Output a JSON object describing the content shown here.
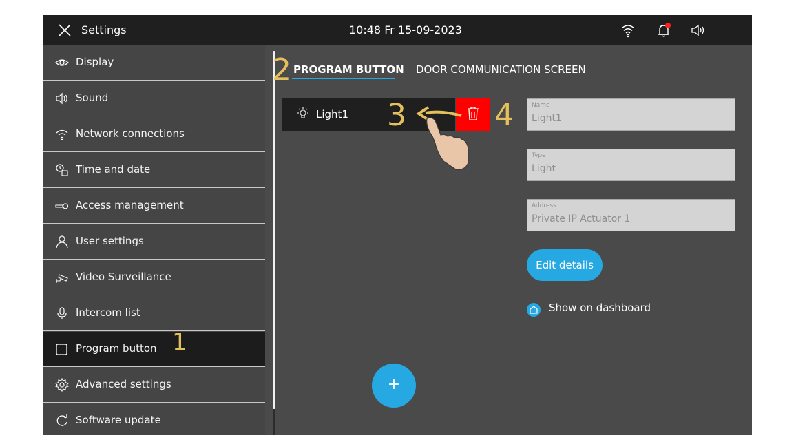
{
  "topbar": {
    "title": "Settings",
    "clock": "10:48  Fr 15-09-2023",
    "icons": [
      "close-icon",
      "wifi-icon",
      "bell-icon",
      "speaker-icon"
    ],
    "notification_color": "#ff2020"
  },
  "sidebar": {
    "items": [
      {
        "label": "Display",
        "icon": "eye-icon"
      },
      {
        "label": "Sound",
        "icon": "speaker-icon"
      },
      {
        "label": "Network connections",
        "icon": "wifi-icon"
      },
      {
        "label": "Time and date",
        "icon": "clock-calendar-icon"
      },
      {
        "label": "Access  management",
        "icon": "key-icon"
      },
      {
        "label": "User settings",
        "icon": "user-icon"
      },
      {
        "label": "Video Surveillance",
        "icon": "camera-icon"
      },
      {
        "label": "Intercom list",
        "icon": "microphone-icon"
      },
      {
        "label": "Program button",
        "icon": "square-icon",
        "active": true
      },
      {
        "label": "Advanced settings",
        "icon": "gear-icon"
      },
      {
        "label": "Software update",
        "icon": "refresh-icon"
      }
    ]
  },
  "tabs": [
    {
      "label": "PROGRAM BUTTON",
      "active": true
    },
    {
      "label": "DOOR COMMUNICATION SCREEN",
      "active": false
    }
  ],
  "program_list": {
    "items": [
      {
        "label": "Light1",
        "icon": "light-bulb-icon"
      }
    ],
    "delete_icon": "trash-icon",
    "delete_color": "#ff0000"
  },
  "details": {
    "name": {
      "label": "Name",
      "value": "Light1"
    },
    "type": {
      "label": "Type",
      "value": "Light"
    },
    "address": {
      "label": "Address",
      "value": "Private IP Actuator 1"
    },
    "edit_button": "Edit details",
    "show_on_dashboard": "Show on dashboard"
  },
  "add_button": "+",
  "annotations": {
    "step1": "1",
    "step2": "2",
    "step3": "3",
    "step4": "4"
  },
  "colors": {
    "accent": "#26a8e3",
    "annotation": "#e4c05d",
    "topbar": "#1f1f1f",
    "panel": "#4a4a4a"
  }
}
